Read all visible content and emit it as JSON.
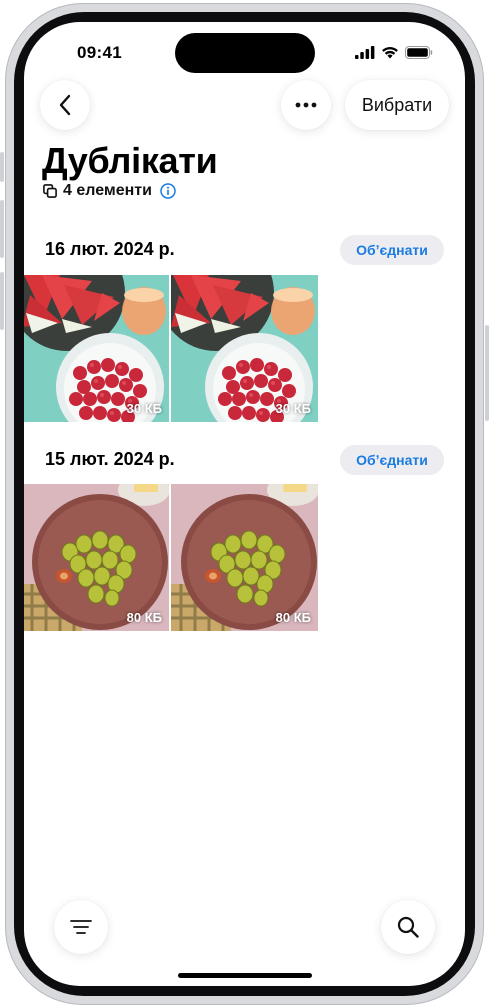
{
  "status_bar": {
    "time": "09:41"
  },
  "toolbar": {
    "back_icon": "chevron-left-icon",
    "more_icon": "ellipsis-icon",
    "select_label": "Вибрати"
  },
  "header": {
    "title": "Дублікати",
    "count_label": "4 елементи",
    "count_icon": "copy-icon",
    "info_icon": "info-icon"
  },
  "groups": [
    {
      "date": "16 лют. 2024 р.",
      "merge_label": "Обʼєднати",
      "items": [
        {
          "size": "30 КБ",
          "subject": "raspberries-watermelon"
        },
        {
          "size": "30 КБ",
          "subject": "raspberries-watermelon"
        }
      ]
    },
    {
      "date": "15 лют. 2024 р.",
      "merge_label": "Обʼєднати",
      "items": [
        {
          "size": "80 КБ",
          "subject": "figs-plate"
        },
        {
          "size": "80 КБ",
          "subject": "figs-plate"
        }
      ]
    }
  ],
  "bottom_bar": {
    "filter_icon": "filter-lines-icon",
    "search_icon": "search-icon"
  },
  "colors": {
    "accent": "#1a7ce0",
    "chip_bg": "#ececf1"
  }
}
